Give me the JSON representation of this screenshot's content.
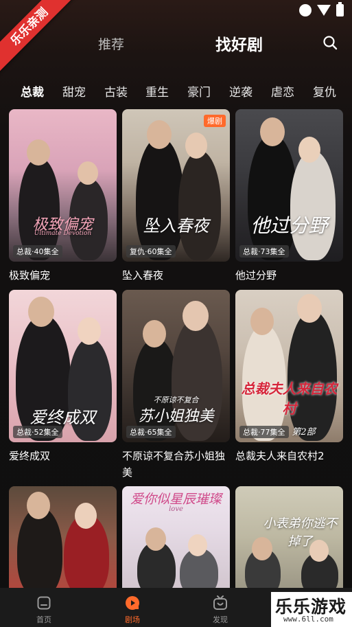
{
  "ribbon": {
    "text": "乐乐亲测"
  },
  "top_nav": {
    "tabs": [
      {
        "label": "推荐",
        "active": false
      },
      {
        "label": "找好剧",
        "active": true
      }
    ],
    "search_icon": "search-icon"
  },
  "categories": [
    "总裁",
    "甜宠",
    "古装",
    "重生",
    "豪门",
    "逆袭",
    "虐恋",
    "复仇"
  ],
  "active_category": "总裁",
  "dramas": [
    {
      "title": "极致偏宠",
      "ep_label": "总裁·40集全",
      "poster_text": "极致偏宠",
      "poster_sub": "Ultimate Devotion",
      "hot": ""
    },
    {
      "title": "坠入春夜",
      "ep_label": "复仇·60集全",
      "poster_text": "坠入春夜",
      "hot": "爆剧"
    },
    {
      "title": "他过分野",
      "ep_label": "总裁·73集全",
      "poster_text": "他过分野",
      "hot": ""
    },
    {
      "title": "爱终成双",
      "ep_label": "总裁·52集全",
      "poster_text": "爱终成双",
      "hot": ""
    },
    {
      "title": "不原谅不复合苏小姐独美",
      "ep_label": "总裁·65集全",
      "poster_text": "苏小姐独美",
      "poster_top": "不原谅不复合",
      "hot": ""
    },
    {
      "title": "总裁夫人来自农村2",
      "ep_label": "总裁·77集全",
      "poster_text": "总裁夫人来自农村",
      "poster_sub": "第2部",
      "hot": ""
    },
    {
      "title": "",
      "ep_label": "",
      "poster_text": "",
      "hot": ""
    },
    {
      "title": "",
      "ep_label": "",
      "poster_text": "爱你似星辰璀璨",
      "poster_sub": "love",
      "hot": ""
    },
    {
      "title": "",
      "ep_label": "",
      "poster_text": "小表弟你逃不掉了",
      "hot": ""
    }
  ],
  "bottom_nav": [
    {
      "label": "首页",
      "icon": "home-icon",
      "active": false
    },
    {
      "label": "剧场",
      "icon": "theater-icon",
      "active": true
    },
    {
      "label": "发现",
      "icon": "tv-icon",
      "active": false
    }
  ],
  "watermark": {
    "main": "乐乐游戏",
    "sub": "www.6ll.com"
  },
  "colors": {
    "accent": "#ff6a2b",
    "ribbon": "#e0312f",
    "background": "#0f0f0f"
  }
}
